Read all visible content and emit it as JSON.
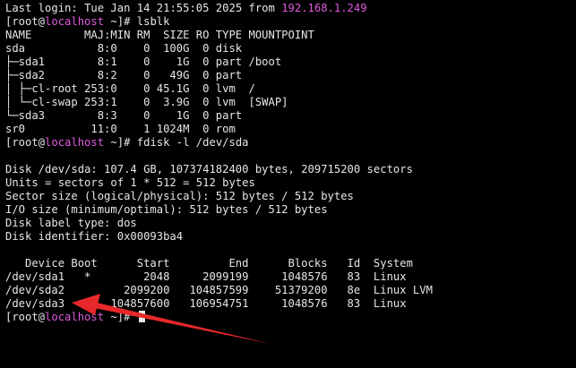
{
  "login": {
    "prefix": "Last login: ",
    "date": "Tue Jan 14 21:55:05 2025 from ",
    "ip": "192.168.1.249"
  },
  "prompt": {
    "open": "[root@",
    "host": "localhost",
    "close": " ~]# "
  },
  "cmd1": "lsblk",
  "lsblk": {
    "header": "NAME        MAJ:MIN RM  SIZE RO TYPE MOUNTPOINT",
    "rows": [
      "sda           8:0    0  100G  0 disk",
      "├─sda1        8:1    0    1G  0 part /boot",
      "├─sda2        8:2    0   49G  0 part",
      "│ ├─cl-root 253:0    0 45.1G  0 lvm  /",
      "│ └─cl-swap 253:1    0  3.9G  0 lvm  [SWAP]",
      "└─sda3        8:3    0    1G  0 part",
      "sr0          11:0    1 1024M  0 rom"
    ]
  },
  "cmd2": "fdisk -l /dev/sda",
  "fdisk": {
    "info": [
      "Disk /dev/sda: 107.4 GB, 107374182400 bytes, 209715200 sectors",
      "Units = sectors of 1 * 512 = 512 bytes",
      "Sector size (logical/physical): 512 bytes / 512 bytes",
      "I/O size (minimum/optimal): 512 bytes / 512 bytes",
      "Disk label type: dos",
      "Disk identifier: 0x00093ba4"
    ],
    "table_header": "   Device Boot      Start         End      Blocks   Id  System",
    "table_rows": [
      "/dev/sda1   *        2048     2099199     1048576   83  Linux",
      "/dev/sda2         2099200   104857599    51379200   8e  Linux LVM",
      "/dev/sda3       104857600   106954751     1048576   83  Linux"
    ]
  },
  "colors": {
    "background": "#000000",
    "text": "#e6e6e6",
    "hostname": "#e05adf",
    "arrow": "#e8282b"
  }
}
